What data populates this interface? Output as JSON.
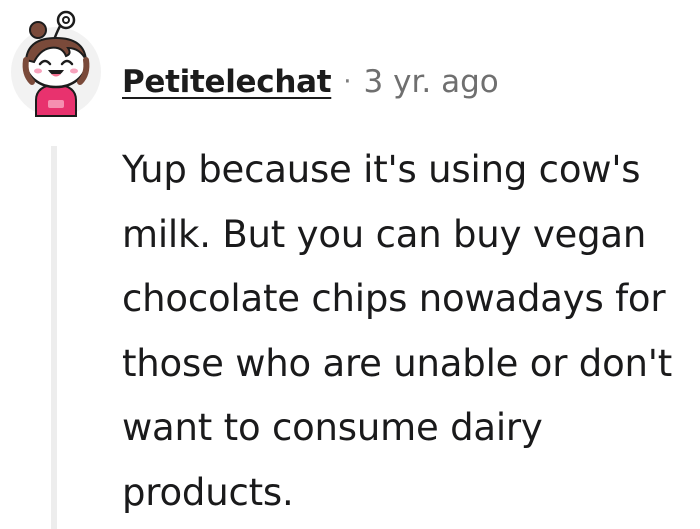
{
  "comment": {
    "author": "Petitelechat",
    "separator": "·",
    "timestamp": "3 yr. ago",
    "body": "Yup because it's using cow's milk. But you can buy vegan chocolate chips nowadays for those who are unable or don't want to consume dairy products."
  },
  "avatar": {
    "icon": "snoo-avatar-icon",
    "hoodie_color": "#e8326e",
    "hair_color": "#7a4a3a"
  }
}
